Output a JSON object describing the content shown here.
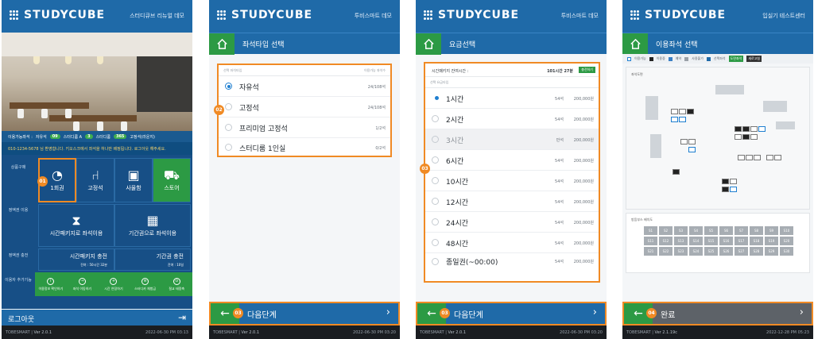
{
  "app": {
    "logo": "STUDYCUBE",
    "footer_brand": "TOBESMART"
  },
  "screen1": {
    "store": "스터디큐브 리뉴얼 데모",
    "stats": {
      "label": "이용가능좌석 :",
      "free_label": "자유석",
      "free": "09",
      "fixed_label": "스터디룸 A",
      "fixed": "3",
      "room_label": "스터디룸",
      "room": "365",
      "premium_label": "고정석(라운지)"
    },
    "notice": "010-1234-5678 님 환영합니다. 키오스크에서 좌석을 하나만 배정됩니다. 로그아웃 해주세요.",
    "row_labels": [
      "상품구매",
      "정액권 이용",
      "정액권 충전",
      "이용자 추가기능"
    ],
    "tiles": {
      "t1": "1회권",
      "t2": "고정석",
      "t3": "사물함",
      "t4": "스토어",
      "t5": "시간패키지로 좌석이용",
      "t6": "기간권으로 좌석이용",
      "t7": "시간패키지 충전",
      "t7s": "잔여 : 50시간 32분",
      "t8": "기간권 충전",
      "t8s": "잔여 : 10일"
    },
    "small": [
      "이용정보 확인하기",
      "좌석 이동하기",
      "시간 연장하기",
      "스터디카 체험금",
      "절교 태정축"
    ],
    "logout": "로그아웃",
    "badge": "01",
    "footer_ver": "Ver 2.0.1",
    "footer_time": "2022-06-30   PM 03:13"
  },
  "screen2": {
    "store": "투비스마트 데모",
    "title": "좌석타입 선택",
    "head_left": "선택   좌석타입",
    "head_right": "이용가능 좌석수",
    "items": [
      {
        "label": "자유석",
        "right": "24/108석"
      },
      {
        "label": "고정석",
        "right": "24/108석"
      },
      {
        "label": "프리미엄 고정석",
        "right": "1/2석"
      },
      {
        "label": "스터디룸 1인실",
        "right": "0/2석"
      }
    ],
    "next": "다음단계",
    "badge_list": "02",
    "badge_next": "03",
    "footer_ver": "Ver 2.0.1",
    "footer_time": "2022-06-30   PM 03:20"
  },
  "screen3": {
    "store": "투비스마트 데모",
    "title": "요금선택",
    "remain_label": "시간패키지 잔여시간 :",
    "remain_value": "101시간 27분",
    "remain_btn": "충전하기",
    "head_left": "선택   요금타입",
    "items": [
      {
        "label": "1시간",
        "seat": "54석",
        "price": "200,000원"
      },
      {
        "label": "2시간",
        "seat": "54석",
        "price": "200,000원"
      },
      {
        "label": "3시간",
        "seat": "만석",
        "price": "200,000원"
      },
      {
        "label": "6시간",
        "seat": "54석",
        "price": "200,000원"
      },
      {
        "label": "10시간",
        "seat": "54석",
        "price": "200,000원"
      },
      {
        "label": "12시간",
        "seat": "54석",
        "price": "200,000원"
      },
      {
        "label": "24시간",
        "seat": "54석",
        "price": "200,000원"
      },
      {
        "label": "48시간",
        "seat": "54석",
        "price": "200,000원"
      },
      {
        "label": "종일권(~00:00)",
        "seat": "54석",
        "price": "200,000원"
      }
    ],
    "next": "다음단계",
    "badge_list": "03",
    "badge_next": "03",
    "footer_ver": "Ver 2.0.1",
    "footer_time": "2022-06-30   PM 03:20"
  },
  "screen4": {
    "store": "입실기 테스트센터",
    "title": "이용좌석 선택",
    "legend": [
      "이용가능",
      "이용중",
      "예약",
      "사용불가",
      "선택좌석"
    ],
    "legend_btn1": "도면좌석",
    "legend_btn2": "새로고침",
    "floor_label": "좌석도면",
    "room_label": "방음부스 배치도",
    "rooms": [
      "S1",
      "S2",
      "S3",
      "S4",
      "S5",
      "S6",
      "S7",
      "S8",
      "S9",
      "S10",
      "S11",
      "S12",
      "S13",
      "S14",
      "S15",
      "S16",
      "S17",
      "S18",
      "S19",
      "S20",
      "S21",
      "S22",
      "S23",
      "S24",
      "S25",
      "S26",
      "S27",
      "S28",
      "S29",
      "S30"
    ],
    "next": "완료",
    "badge": "04",
    "footer_ver": "Ver 2.1.19c",
    "footer_time": "2022-12-28   PM 05:23"
  }
}
